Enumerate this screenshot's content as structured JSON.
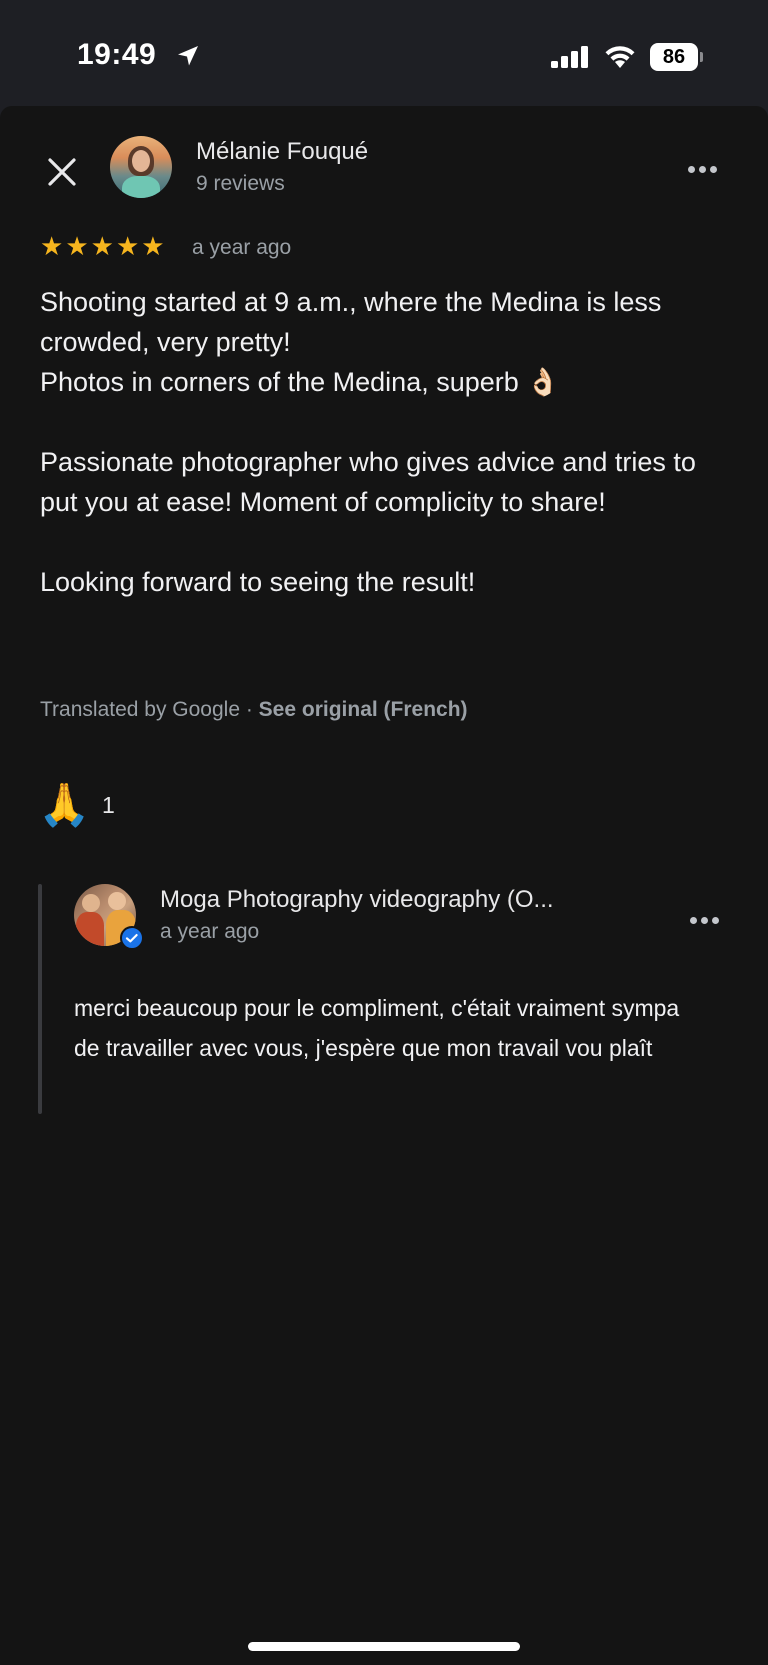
{
  "status_bar": {
    "time": "19:49",
    "battery": "86"
  },
  "review": {
    "author_name": "Mélanie Fouqué",
    "author_reviews": "9 reviews",
    "rating": 5,
    "time": "a year ago",
    "paragraphs": [
      "Shooting started at 9 a.m., where the Medina is less crowded, very pretty!\nPhotos in corners of the Medina, superb 👌🏻",
      "Passionate photographer who gives advice and tries to put you at ease! Moment of complicity to share!",
      "Looking forward to seeing the result!"
    ],
    "translated_prefix": "Translated by Google · ",
    "see_original": "See original (French)",
    "reaction_emoji": "🙏",
    "reaction_count": "1"
  },
  "reply": {
    "owner_name": "Moga Photography videography (O...",
    "time": "a year ago",
    "text": "merci beaucoup pour le compliment, c'était vraiment sympa de travailler avec vous, j'espère que mon travail vou plaît"
  },
  "colors": {
    "star": "#f6b51e",
    "sheet_bg": "#141414",
    "secondary_text": "#9aa0a6",
    "verified_badge": "#1a73e8"
  },
  "icons": [
    "location-arrow-icon",
    "signal-icon",
    "wifi-icon",
    "battery-icon",
    "close-icon",
    "more-options-icon",
    "star-icon",
    "verified-icon"
  ]
}
